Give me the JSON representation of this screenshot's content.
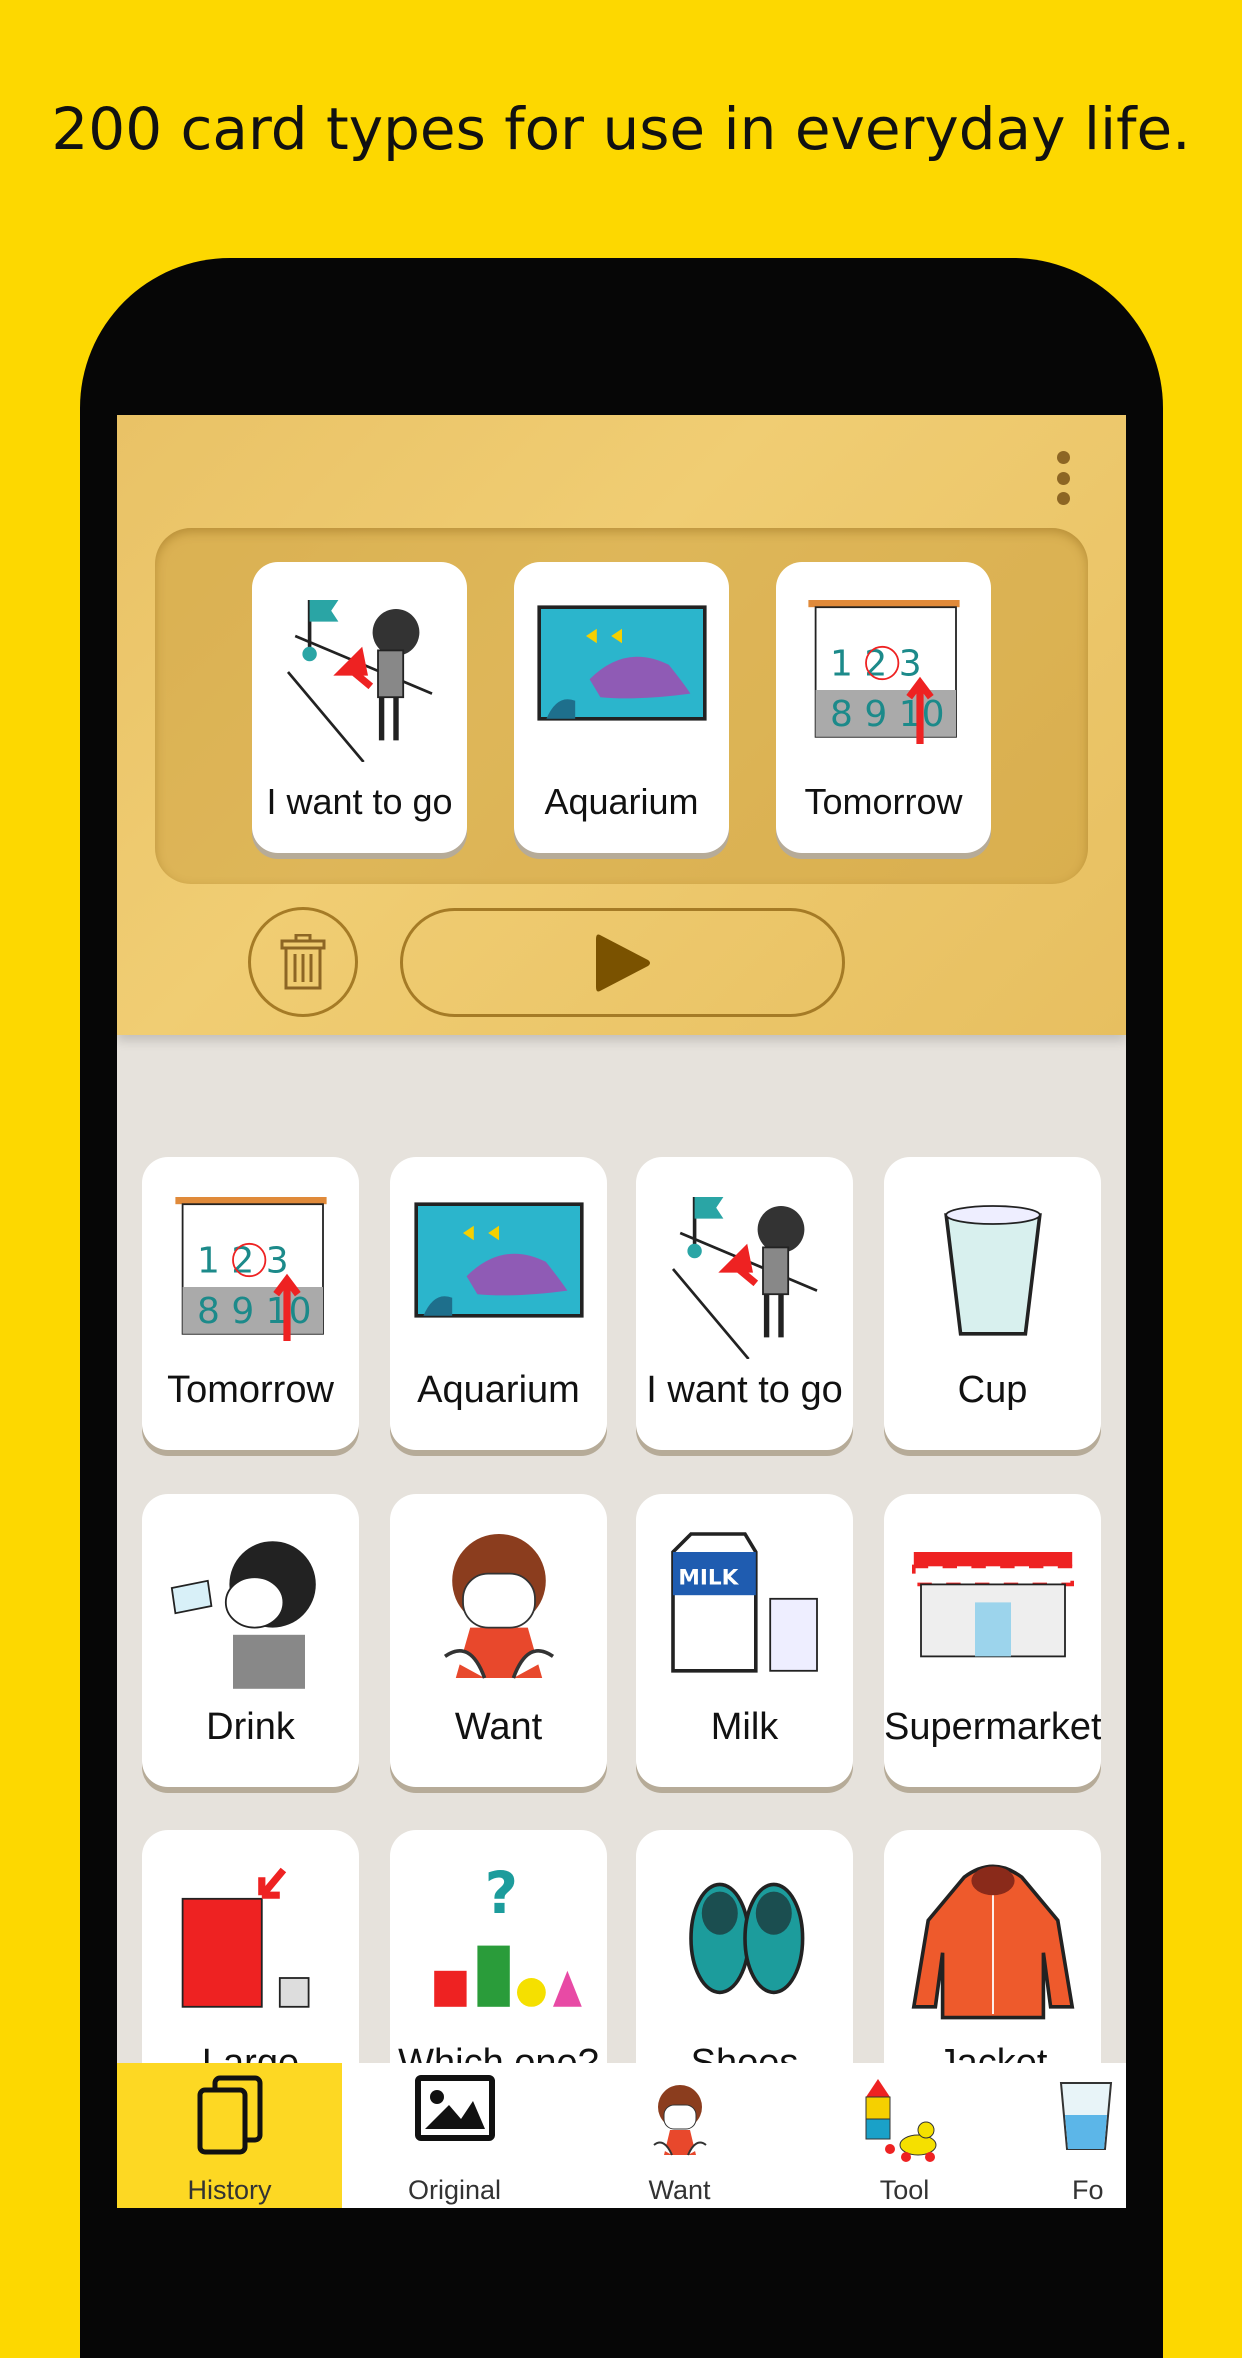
{
  "headline": "200 card types for use in everyday life.",
  "sentence_cards": [
    {
      "label": "I want to go",
      "icon": "go-icon"
    },
    {
      "label": "Aquarium",
      "icon": "aquarium-icon"
    },
    {
      "label": "Tomorrow",
      "icon": "calendar-icon"
    }
  ],
  "grid_cards": [
    {
      "label": "Tomorrow",
      "icon": "calendar-icon"
    },
    {
      "label": "Aquarium",
      "icon": "aquarium-icon"
    },
    {
      "label": "I want to go",
      "icon": "go-icon"
    },
    {
      "label": "Cup",
      "icon": "cup-icon"
    },
    {
      "label": "Drink",
      "icon": "drink-icon"
    },
    {
      "label": "Want",
      "icon": "girl-icon"
    },
    {
      "label": "Milk",
      "icon": "milk-icon"
    },
    {
      "label": "Supermarket",
      "icon": "store-icon"
    },
    {
      "label": "Large",
      "icon": "large-icon"
    },
    {
      "label": "Which one?",
      "icon": "which-icon"
    },
    {
      "label": "Shoes",
      "icon": "shoes-icon"
    },
    {
      "label": "Jacket",
      "icon": "jacket-icon"
    }
  ],
  "milk_text": "MILK",
  "nav": [
    {
      "label": "History",
      "active": true
    },
    {
      "label": "Original"
    },
    {
      "label": "Want"
    },
    {
      "label": "Tool"
    },
    {
      "label": "Fo"
    }
  ],
  "colors": {
    "background": "#fdd800",
    "wood": "#ecc66b",
    "active_tab": "#fdd823",
    "grid_bg": "#e6e2dc"
  }
}
